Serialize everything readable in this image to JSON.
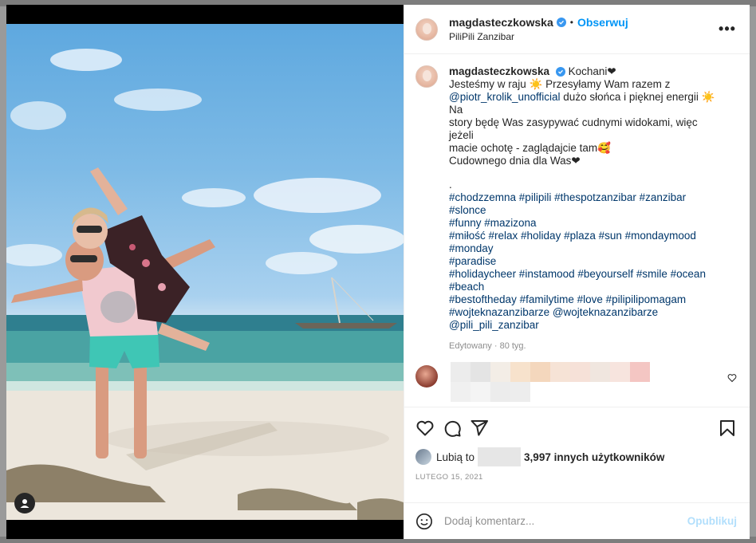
{
  "post": {
    "username": "magdasteczkowska",
    "follow_label": "Obserwuj",
    "separator": "•",
    "location": "PiliPili Zanzibar",
    "more_label": "•••"
  },
  "caption": {
    "username": "magdasteczkowska",
    "line1": "Kochani❤",
    "line2_a": "Jesteśmy w raju",
    "line2_b": "Przesyłamy Wam razem z",
    "mention": "@piotr_krolik_unofficial",
    "line3_b": "dużo słońca i pięknej energii",
    "line3_c": "Na",
    "line4": "story będę Was zasypywać cudnymi widokami, więc jeżeli",
    "line5": "macie ochotę - zaglądajcie tam🥰",
    "line6": "Cudownego dnia dla Was❤",
    "line7": ".",
    "hashtags": [
      "#chodzzemna #pilipili #thespotzanzibar #zanzibar #slonce",
      "#funny #mazizona",
      "#miłość #relax #holiday #plaza #sun #mondaymood #monday",
      "#paradise",
      "#holidaycheer #instamood #beyourself #smile #ocean #beach",
      "#bestoftheday #familytime #love #pilipilipomagam",
      "#wojteknazanzibarze @wojteknazanzibarze",
      "@pili_pili_zanzibar"
    ],
    "meta": "Edytowany · 80 tyg."
  },
  "likes": {
    "prefix": "Lubią to",
    "suffix": "3,997 innych użytkowników"
  },
  "date": "LUTEGO 15, 2021",
  "comment_box": {
    "placeholder": "Dodaj komentarz...",
    "post_label": "Opublikuj"
  },
  "icons": [
    "verified-icon",
    "heart-icon",
    "comment-icon",
    "share-icon",
    "bookmark-icon",
    "emoji-icon",
    "user-tag-icon"
  ],
  "colors": {
    "accent": "#0095f6",
    "link": "#00376b",
    "muted": "#8e8e8e",
    "post_disabled": "#b2dffc"
  }
}
